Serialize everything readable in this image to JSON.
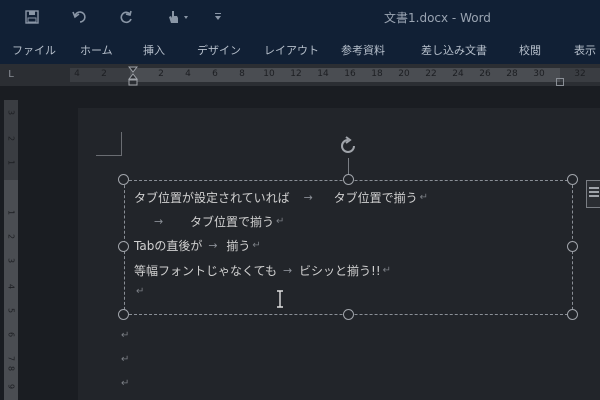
{
  "titlebar": {
    "title": "文書1.docx  -  Word",
    "qat": [
      {
        "icon": "save-icon"
      },
      {
        "icon": "undo-icon"
      },
      {
        "icon": "redo-icon"
      },
      {
        "icon": "touch-mode-icon"
      },
      {
        "icon": "customize-qat-icon"
      }
    ]
  },
  "ribbon": {
    "tabs": [
      "ファイル",
      "ホーム",
      "挿入",
      "デザイン",
      "レイアウト",
      "参考資料",
      "差し込み文書",
      "校閲",
      "表示"
    ]
  },
  "ruler": {
    "corner_label": "L",
    "h_ticks": [
      "4",
      "2",
      "2",
      "4",
      "6",
      "8",
      "10",
      "12",
      "14",
      "16",
      "18",
      "20",
      "22",
      "24",
      "26",
      "28",
      "30",
      "32"
    ],
    "v_ticks": [
      "3",
      "2",
      "1",
      "1",
      "2",
      "3",
      "4",
      "5",
      "6",
      "7",
      "8",
      "9"
    ]
  },
  "textbox": {
    "lines": [
      {
        "before": "タブ位置が設定されていれば",
        "arrow": "→",
        "after": "タブ位置で揃う",
        "mark": "↵"
      },
      {
        "before": "",
        "arrow": "→",
        "after": "タブ位置で揃う",
        "mark": "↵"
      },
      {
        "before": "Tabの直後が",
        "arrow": "→",
        "after": "揃う",
        "mark": "↵"
      },
      {
        "before": "等幅フォントじゃなくても",
        "arrow": "→",
        "after": "ビシッと揃う!!",
        "mark": "↵"
      },
      {
        "before": "",
        "arrow": "",
        "after": "",
        "mark": "↵"
      }
    ]
  },
  "page": {
    "empty_paragraph_marks": [
      "↵",
      "↵",
      "↵"
    ]
  },
  "colors": {
    "title_bar": "#112035",
    "page": "#22252a",
    "background": "#1a1d22"
  }
}
